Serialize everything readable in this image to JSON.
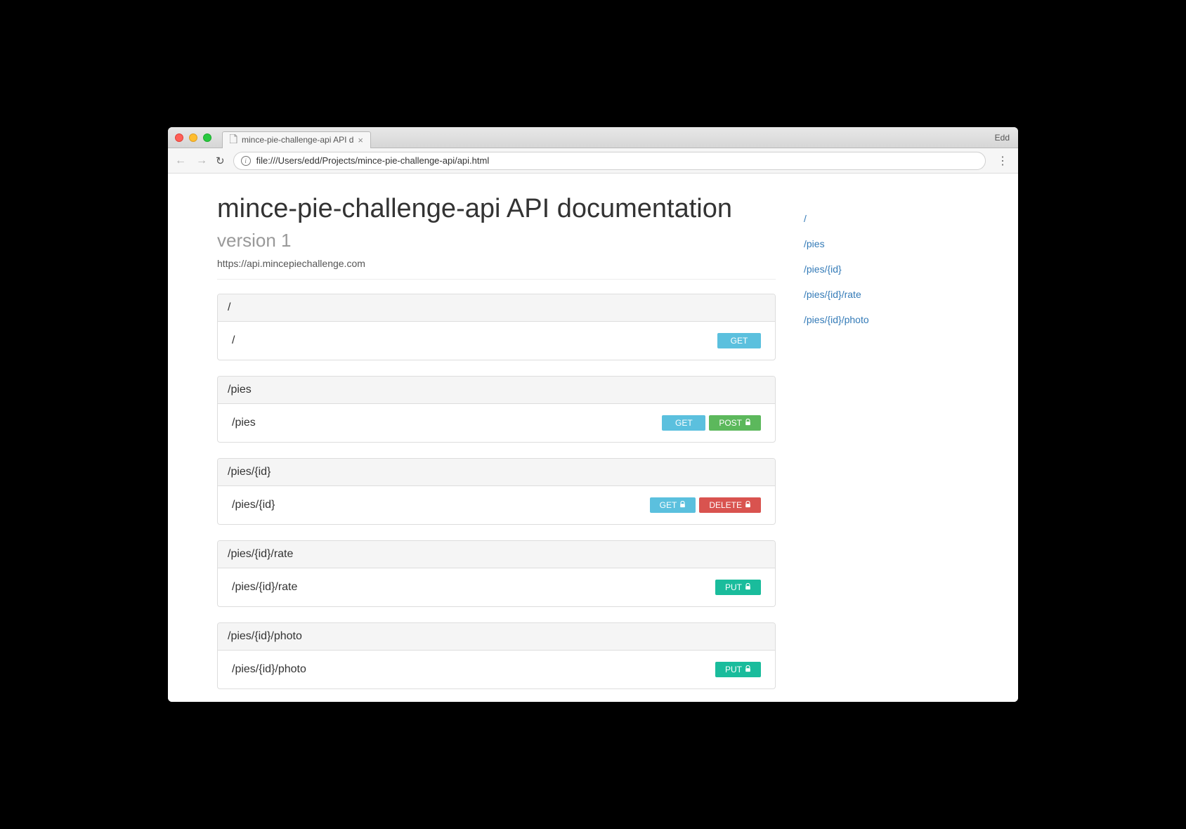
{
  "browser": {
    "tab_title": "mince-pie-challenge-api API d",
    "profile": "Edd",
    "url": "file:///Users/edd/Projects/mince-pie-challenge-api/api.html"
  },
  "page": {
    "title": "mince-pie-challenge-api API documentation",
    "version_label": "version 1",
    "base_url": "https://api.mincepiechallenge.com"
  },
  "resources": [
    {
      "header": "/",
      "path": "/",
      "methods": [
        {
          "verb": "GET",
          "class": "m-get",
          "secured": false
        }
      ]
    },
    {
      "header": "/pies",
      "path": "/pies",
      "methods": [
        {
          "verb": "GET",
          "class": "m-get",
          "secured": false
        },
        {
          "verb": "POST",
          "class": "m-post",
          "secured": true
        }
      ]
    },
    {
      "header": "/pies/{id}",
      "path": "/pies/{id}",
      "methods": [
        {
          "verb": "GET",
          "class": "m-get",
          "secured": true
        },
        {
          "verb": "DELETE",
          "class": "m-delete",
          "secured": true
        }
      ]
    },
    {
      "header": "/pies/{id}/rate",
      "path": "/pies/{id}/rate",
      "methods": [
        {
          "verb": "PUT",
          "class": "m-put",
          "secured": true
        }
      ]
    },
    {
      "header": "/pies/{id}/photo",
      "path": "/pies/{id}/photo",
      "methods": [
        {
          "verb": "PUT",
          "class": "m-put",
          "secured": true
        }
      ]
    }
  ],
  "nav": [
    {
      "label": "/"
    },
    {
      "label": "/pies"
    },
    {
      "label": "/pies/{id}"
    },
    {
      "label": "/pies/{id}/rate"
    },
    {
      "label": "/pies/{id}/photo"
    }
  ]
}
